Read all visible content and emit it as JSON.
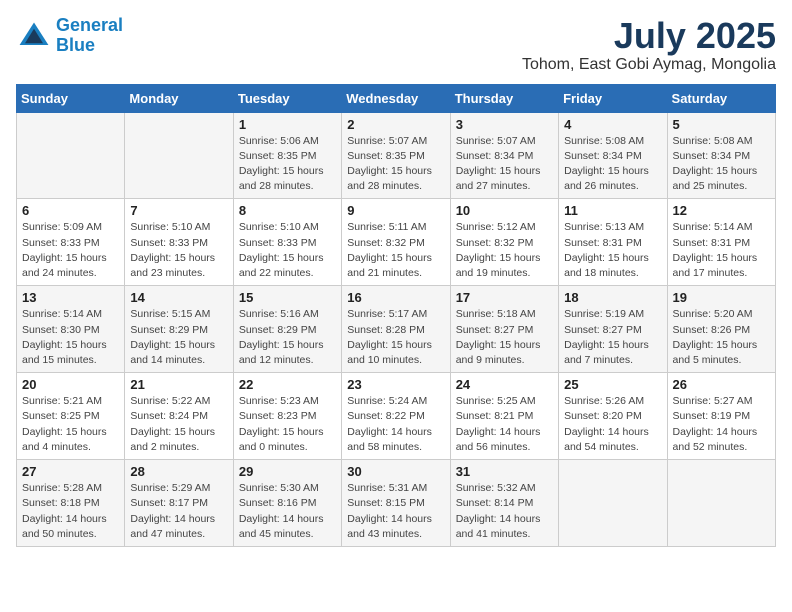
{
  "header": {
    "logo_line1": "General",
    "logo_line2": "Blue",
    "month": "July 2025",
    "location": "Tohom, East Gobi Aymag, Mongolia"
  },
  "weekdays": [
    "Sunday",
    "Monday",
    "Tuesday",
    "Wednesday",
    "Thursday",
    "Friday",
    "Saturday"
  ],
  "weeks": [
    [
      {
        "day": "",
        "detail": ""
      },
      {
        "day": "",
        "detail": ""
      },
      {
        "day": "1",
        "detail": "Sunrise: 5:06 AM\nSunset: 8:35 PM\nDaylight: 15 hours\nand 28 minutes."
      },
      {
        "day": "2",
        "detail": "Sunrise: 5:07 AM\nSunset: 8:35 PM\nDaylight: 15 hours\nand 28 minutes."
      },
      {
        "day": "3",
        "detail": "Sunrise: 5:07 AM\nSunset: 8:34 PM\nDaylight: 15 hours\nand 27 minutes."
      },
      {
        "day": "4",
        "detail": "Sunrise: 5:08 AM\nSunset: 8:34 PM\nDaylight: 15 hours\nand 26 minutes."
      },
      {
        "day": "5",
        "detail": "Sunrise: 5:08 AM\nSunset: 8:34 PM\nDaylight: 15 hours\nand 25 minutes."
      }
    ],
    [
      {
        "day": "6",
        "detail": "Sunrise: 5:09 AM\nSunset: 8:33 PM\nDaylight: 15 hours\nand 24 minutes."
      },
      {
        "day": "7",
        "detail": "Sunrise: 5:10 AM\nSunset: 8:33 PM\nDaylight: 15 hours\nand 23 minutes."
      },
      {
        "day": "8",
        "detail": "Sunrise: 5:10 AM\nSunset: 8:33 PM\nDaylight: 15 hours\nand 22 minutes."
      },
      {
        "day": "9",
        "detail": "Sunrise: 5:11 AM\nSunset: 8:32 PM\nDaylight: 15 hours\nand 21 minutes."
      },
      {
        "day": "10",
        "detail": "Sunrise: 5:12 AM\nSunset: 8:32 PM\nDaylight: 15 hours\nand 19 minutes."
      },
      {
        "day": "11",
        "detail": "Sunrise: 5:13 AM\nSunset: 8:31 PM\nDaylight: 15 hours\nand 18 minutes."
      },
      {
        "day": "12",
        "detail": "Sunrise: 5:14 AM\nSunset: 8:31 PM\nDaylight: 15 hours\nand 17 minutes."
      }
    ],
    [
      {
        "day": "13",
        "detail": "Sunrise: 5:14 AM\nSunset: 8:30 PM\nDaylight: 15 hours\nand 15 minutes."
      },
      {
        "day": "14",
        "detail": "Sunrise: 5:15 AM\nSunset: 8:29 PM\nDaylight: 15 hours\nand 14 minutes."
      },
      {
        "day": "15",
        "detail": "Sunrise: 5:16 AM\nSunset: 8:29 PM\nDaylight: 15 hours\nand 12 minutes."
      },
      {
        "day": "16",
        "detail": "Sunrise: 5:17 AM\nSunset: 8:28 PM\nDaylight: 15 hours\nand 10 minutes."
      },
      {
        "day": "17",
        "detail": "Sunrise: 5:18 AM\nSunset: 8:27 PM\nDaylight: 15 hours\nand 9 minutes."
      },
      {
        "day": "18",
        "detail": "Sunrise: 5:19 AM\nSunset: 8:27 PM\nDaylight: 15 hours\nand 7 minutes."
      },
      {
        "day": "19",
        "detail": "Sunrise: 5:20 AM\nSunset: 8:26 PM\nDaylight: 15 hours\nand 5 minutes."
      }
    ],
    [
      {
        "day": "20",
        "detail": "Sunrise: 5:21 AM\nSunset: 8:25 PM\nDaylight: 15 hours\nand 4 minutes."
      },
      {
        "day": "21",
        "detail": "Sunrise: 5:22 AM\nSunset: 8:24 PM\nDaylight: 15 hours\nand 2 minutes."
      },
      {
        "day": "22",
        "detail": "Sunrise: 5:23 AM\nSunset: 8:23 PM\nDaylight: 15 hours\nand 0 minutes."
      },
      {
        "day": "23",
        "detail": "Sunrise: 5:24 AM\nSunset: 8:22 PM\nDaylight: 14 hours\nand 58 minutes."
      },
      {
        "day": "24",
        "detail": "Sunrise: 5:25 AM\nSunset: 8:21 PM\nDaylight: 14 hours\nand 56 minutes."
      },
      {
        "day": "25",
        "detail": "Sunrise: 5:26 AM\nSunset: 8:20 PM\nDaylight: 14 hours\nand 54 minutes."
      },
      {
        "day": "26",
        "detail": "Sunrise: 5:27 AM\nSunset: 8:19 PM\nDaylight: 14 hours\nand 52 minutes."
      }
    ],
    [
      {
        "day": "27",
        "detail": "Sunrise: 5:28 AM\nSunset: 8:18 PM\nDaylight: 14 hours\nand 50 minutes."
      },
      {
        "day": "28",
        "detail": "Sunrise: 5:29 AM\nSunset: 8:17 PM\nDaylight: 14 hours\nand 47 minutes."
      },
      {
        "day": "29",
        "detail": "Sunrise: 5:30 AM\nSunset: 8:16 PM\nDaylight: 14 hours\nand 45 minutes."
      },
      {
        "day": "30",
        "detail": "Sunrise: 5:31 AM\nSunset: 8:15 PM\nDaylight: 14 hours\nand 43 minutes."
      },
      {
        "day": "31",
        "detail": "Sunrise: 5:32 AM\nSunset: 8:14 PM\nDaylight: 14 hours\nand 41 minutes."
      },
      {
        "day": "",
        "detail": ""
      },
      {
        "day": "",
        "detail": ""
      }
    ]
  ]
}
